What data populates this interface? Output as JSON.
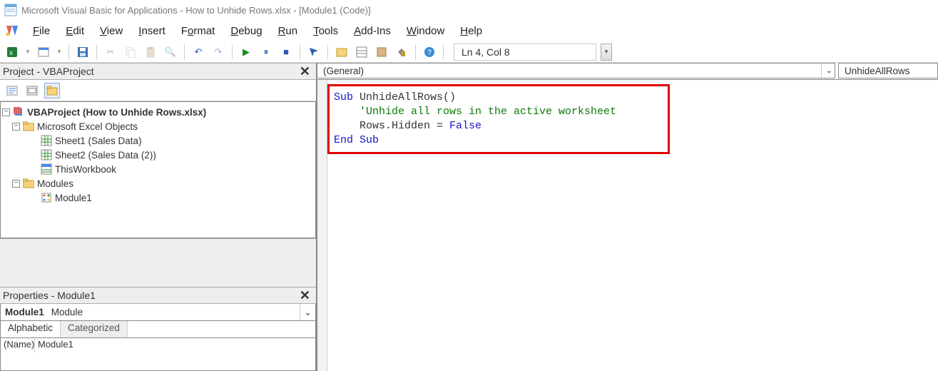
{
  "title": "Microsoft Visual Basic for Applications - How to Unhide Rows.xlsx - [Module1 (Code)]",
  "menus": {
    "file": "File",
    "edit": "Edit",
    "view": "View",
    "insert": "Insert",
    "format": "Format",
    "debug": "Debug",
    "run": "Run",
    "tools": "Tools",
    "addins": "Add-Ins",
    "window": "Window",
    "help": "Help"
  },
  "toolbar": {
    "cursor": "Ln 4, Col 8"
  },
  "project": {
    "title": "Project - VBAProject",
    "root": "VBAProject (How to Unhide Rows.xlsx)",
    "excel_objects": "Microsoft Excel Objects",
    "sheet1": "Sheet1 (Sales Data)",
    "sheet2": "Sheet2 (Sales Data (2))",
    "thiswb": "ThisWorkbook",
    "modules": "Modules",
    "module1": "Module1"
  },
  "properties": {
    "title": "Properties - Module1",
    "obj_name": "Module1",
    "obj_type": "Module",
    "tab_alpha": "Alphabetic",
    "tab_cat": "Categorized",
    "prop_name_label": "(Name)",
    "prop_name_value": "Module1"
  },
  "code": {
    "left_combo": "(General)",
    "right_combo": "UnhideAllRows",
    "l1a": "Sub",
    "l1b": " UnhideAllRows()",
    "l2": "    'Unhide all rows in the active worksheet",
    "l3a": "    Rows.Hidden = ",
    "l3b": "False",
    "l4": "End Sub"
  }
}
